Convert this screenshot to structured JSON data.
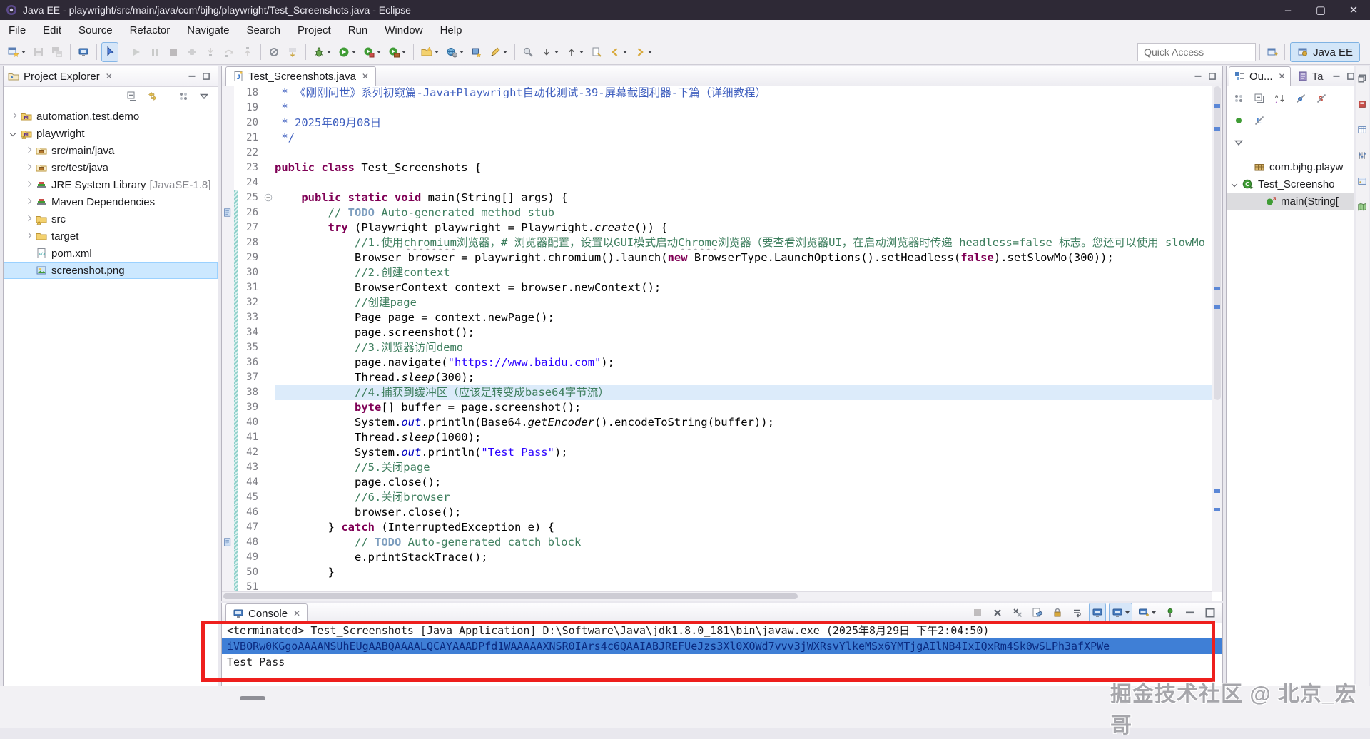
{
  "window": {
    "title": "Java EE - playwright/src/main/java/com/bjhg/playwright/Test_Screenshots.java - Eclipse",
    "minimize_label": "–",
    "maximize_label": "▢",
    "close_label": "✕"
  },
  "menu_bar": {
    "items": [
      "File",
      "Edit",
      "Source",
      "Refactor",
      "Navigate",
      "Search",
      "Project",
      "Run",
      "Window",
      "Help"
    ]
  },
  "toolbar": {
    "quick_access_placeholder": "Quick Access",
    "perspective_label": "Java EE",
    "items": [
      {
        "name": "new-wizard",
        "dropdown": true
      },
      {
        "name": "save",
        "grayed": true
      },
      {
        "name": "save-all",
        "grayed": true
      },
      {
        "sep": true
      },
      {
        "name": "console-view"
      },
      {
        "sep": true
      },
      {
        "name": "debug-pointer",
        "selected": true
      },
      {
        "sep": true
      },
      {
        "name": "resume",
        "grayed": true
      },
      {
        "name": "suspend",
        "grayed": true
      },
      {
        "name": "terminate",
        "grayed": true
      },
      {
        "name": "disconnect",
        "grayed": true
      },
      {
        "name": "step-into",
        "grayed": true
      },
      {
        "name": "step-over",
        "grayed": true
      },
      {
        "name": "step-return",
        "grayed": true
      },
      {
        "sep": true
      },
      {
        "name": "skip-breakpoints"
      },
      {
        "name": "drop-to-frame"
      },
      {
        "sep": true
      },
      {
        "name": "debug",
        "dropdown": true
      },
      {
        "name": "run",
        "dropdown": true
      },
      {
        "name": "coverage",
        "dropdown": true
      },
      {
        "name": "external-tools",
        "dropdown": true
      },
      {
        "sep": true
      },
      {
        "name": "new-project",
        "dropdown": true
      },
      {
        "name": "new-web-service",
        "dropdown": true
      },
      {
        "name": "new-servlet"
      },
      {
        "name": "annotation-pen",
        "dropdown": true
      },
      {
        "sep": true
      },
      {
        "name": "search"
      },
      {
        "name": "next-annotation",
        "dropdown": true
      },
      {
        "name": "prev-annotation",
        "dropdown": true
      },
      {
        "name": "last-edit-location"
      },
      {
        "name": "back",
        "dropdown": true
      },
      {
        "name": "forward",
        "dropdown": true
      }
    ]
  },
  "explorer": {
    "title": "Project Explorer",
    "toolbar": [
      "collapse-all",
      "link-with-editor",
      "focus-dots",
      "view-menu"
    ],
    "items": [
      {
        "label": "automation.test.demo",
        "icon": "maven-project",
        "arrow": "collapsed",
        "level": 0
      },
      {
        "label": "playwright",
        "icon": "maven-project-warn",
        "arrow": "expanded",
        "level": 0
      },
      {
        "label": "src/main/java",
        "icon": "source-folder",
        "arrow": "collapsed",
        "level": 1
      },
      {
        "label": "src/test/java",
        "icon": "source-folder",
        "arrow": "collapsed",
        "level": 1
      },
      {
        "label": "JRE System Library",
        "suffix": "[JavaSE-1.8]",
        "icon": "library",
        "arrow": "collapsed",
        "level": 1
      },
      {
        "label": "Maven Dependencies",
        "icon": "library",
        "arrow": "collapsed",
        "level": 1
      },
      {
        "label": "src",
        "icon": "folder-warn",
        "arrow": "collapsed",
        "level": 1
      },
      {
        "label": "target",
        "icon": "folder",
        "arrow": "collapsed",
        "level": 1
      },
      {
        "label": "pom.xml",
        "icon": "xml-file",
        "arrow": "none",
        "level": 1
      },
      {
        "label": "screenshot.png",
        "icon": "image-file",
        "arrow": "none",
        "level": 1,
        "selected": true
      }
    ]
  },
  "editor": {
    "tab_label": "Test_Screenshots.java",
    "lines": [
      {
        "n": 18,
        "segs": [
          [
            " * 《刚刚问世》系列初窥篇-Java+Playwright自动化测试-39-屏幕截图利器-下篇（详细教程）",
            "j"
          ]
        ]
      },
      {
        "n": 19,
        "segs": [
          [
            " *",
            "j"
          ]
        ]
      },
      {
        "n": 20,
        "segs": [
          [
            " * 2025年09月08日",
            "j"
          ]
        ]
      },
      {
        "n": 21,
        "segs": [
          [
            " */",
            "j"
          ]
        ]
      },
      {
        "n": 22,
        "segs": []
      },
      {
        "n": 23,
        "segs": [
          [
            "public class ",
            "k"
          ],
          [
            "Test_Screenshots {",
            "p"
          ]
        ]
      },
      {
        "n": 24,
        "segs": []
      },
      {
        "n": 25,
        "fold": true,
        "diff": true,
        "segs": [
          [
            "    ",
            "p"
          ],
          [
            "public static void ",
            "k"
          ],
          [
            "main(String[] args) {",
            "p"
          ]
        ]
      },
      {
        "n": 26,
        "diff": true,
        "task": true,
        "segs": [
          [
            "        ",
            "p"
          ],
          [
            "// ",
            "c"
          ],
          [
            "TODO",
            "t"
          ],
          [
            " Auto-generated method stub",
            "c"
          ]
        ]
      },
      {
        "n": 27,
        "diff": true,
        "segs": [
          [
            "        ",
            "p"
          ],
          [
            "try ",
            "k"
          ],
          [
            "(Playwright playwright = Playwright.",
            "p"
          ],
          [
            "create",
            "m"
          ],
          [
            "()) {",
            "p"
          ]
        ]
      },
      {
        "n": 28,
        "diff": true,
        "segs": [
          [
            "            ",
            "p"
          ],
          [
            "//1.使用",
            "c"
          ],
          [
            "chromium",
            "w"
          ],
          [
            "浏览器，# 浏览器配置，设置以GUI模式启动",
            "c"
          ],
          [
            "Chrome",
            "w"
          ],
          [
            "浏览器（要查看浏览器UI，在启动浏览器时传递 headless=false 标志。您还可以使用 slowMo 选项",
            "c"
          ]
        ]
      },
      {
        "n": 29,
        "diff": true,
        "segs": [
          [
            "            Browser browser = playwright.chromium().launch(",
            "p"
          ],
          [
            "new ",
            "k"
          ],
          [
            "BrowserType.LaunchOptions().setHeadless(",
            "p"
          ],
          [
            "false",
            "k"
          ],
          [
            ").setSlowMo(300));",
            "p"
          ]
        ]
      },
      {
        "n": 30,
        "diff": true,
        "segs": [
          [
            "            ",
            "p"
          ],
          [
            "//2.创建context",
            "c"
          ]
        ]
      },
      {
        "n": 31,
        "diff": true,
        "segs": [
          [
            "            BrowserContext context = browser.newContext();",
            "p"
          ]
        ]
      },
      {
        "n": 32,
        "diff": true,
        "segs": [
          [
            "            ",
            "p"
          ],
          [
            "//创建page",
            "c"
          ]
        ]
      },
      {
        "n": 33,
        "diff": true,
        "segs": [
          [
            "            Page page = context.newPage();",
            "p"
          ]
        ]
      },
      {
        "n": 34,
        "diff": true,
        "segs": [
          [
            "            page.screenshot();",
            "p"
          ]
        ]
      },
      {
        "n": 35,
        "diff": true,
        "segs": [
          [
            "            ",
            "p"
          ],
          [
            "//3.浏览器访问demo",
            "c"
          ]
        ]
      },
      {
        "n": 36,
        "diff": true,
        "segs": [
          [
            "            page.navigate(",
            "p"
          ],
          [
            "\"https://www.baidu.com\"",
            "s"
          ],
          [
            ");",
            "p"
          ]
        ]
      },
      {
        "n": 37,
        "diff": true,
        "segs": [
          [
            "            Thread.",
            "p"
          ],
          [
            "sleep",
            "m"
          ],
          [
            "(300);",
            "p"
          ]
        ]
      },
      {
        "n": 38,
        "diff": true,
        "hl": true,
        "segs": [
          [
            "            ",
            "p"
          ],
          [
            "//4.捕获到缓冲区（应该是转变成base64字节流）",
            "c"
          ]
        ]
      },
      {
        "n": 39,
        "diff": true,
        "segs": [
          [
            "            ",
            "p"
          ],
          [
            "byte",
            "k"
          ],
          [
            "[] buffer = page.screenshot();",
            "p"
          ]
        ]
      },
      {
        "n": 40,
        "diff": true,
        "segs": [
          [
            "            System.",
            "p"
          ],
          [
            "out",
            "f"
          ],
          [
            ".println(Base64.",
            "p"
          ],
          [
            "getEncoder",
            "m"
          ],
          [
            "().encodeToString(buffer));",
            "p"
          ]
        ]
      },
      {
        "n": 41,
        "diff": true,
        "segs": [
          [
            "            Thread.",
            "p"
          ],
          [
            "sleep",
            "m"
          ],
          [
            "(1000);",
            "p"
          ]
        ]
      },
      {
        "n": 42,
        "diff": true,
        "segs": [
          [
            "            System.",
            "p"
          ],
          [
            "out",
            "f"
          ],
          [
            ".println(",
            "p"
          ],
          [
            "\"Test Pass\"",
            "s"
          ],
          [
            ");",
            "p"
          ]
        ]
      },
      {
        "n": 43,
        "diff": true,
        "segs": [
          [
            "            ",
            "p"
          ],
          [
            "//5.关闭page",
            "c"
          ]
        ]
      },
      {
        "n": 44,
        "diff": true,
        "segs": [
          [
            "            page.close();",
            "p"
          ]
        ]
      },
      {
        "n": 45,
        "diff": true,
        "segs": [
          [
            "            ",
            "p"
          ],
          [
            "//6.关闭browser",
            "c"
          ]
        ]
      },
      {
        "n": 46,
        "diff": true,
        "segs": [
          [
            "            browser.close();",
            "p"
          ]
        ]
      },
      {
        "n": 47,
        "diff": true,
        "segs": [
          [
            "        } ",
            "p"
          ],
          [
            "catch ",
            "k"
          ],
          [
            "(InterruptedException e) {",
            "p"
          ]
        ]
      },
      {
        "n": 48,
        "diff": true,
        "task": true,
        "segs": [
          [
            "            ",
            "p"
          ],
          [
            "// ",
            "c"
          ],
          [
            "TODO",
            "t"
          ],
          [
            " Auto-generated catch block",
            "c"
          ]
        ]
      },
      {
        "n": 49,
        "diff": true,
        "segs": [
          [
            "            e.printStackTrace();",
            "p"
          ]
        ]
      },
      {
        "n": 50,
        "diff": true,
        "segs": [
          [
            "        }",
            "p"
          ]
        ]
      },
      {
        "n": 51,
        "diff": true,
        "segs": []
      }
    ]
  },
  "outline": {
    "tab_outline": "Ou...",
    "tab_tasks": "Ta",
    "toolbar": [
      "focus-dots",
      "collapse-all",
      "sort-az",
      "hide-fields",
      "hide-static",
      "hide-nonpublic",
      "hide-local"
    ],
    "view_menu": "view-menu",
    "items": [
      {
        "label": "com.bjhg.playw",
        "icon": "package",
        "arrow": "none",
        "level": 1
      },
      {
        "label": "Test_Screensho",
        "icon": "class-run",
        "arrow": "expanded",
        "level": 0
      },
      {
        "label": "main(String[",
        "icon": "method-static",
        "arrow": "none",
        "level": 2,
        "selected": true
      }
    ]
  },
  "console": {
    "tab_label": "Console",
    "toolbar": [
      {
        "name": "terminate-console",
        "grayed": true
      },
      {
        "name": "remove-launch"
      },
      {
        "name": "remove-all-launches"
      },
      {
        "name": "clear-console"
      },
      {
        "name": "scroll-lock"
      },
      {
        "name": "word-wrap"
      },
      {
        "name": "show-stdout",
        "selected": true
      },
      {
        "name": "display-selected-console",
        "selected": true,
        "dropdown": true
      },
      {
        "name": "open-console",
        "dropdown": true
      },
      {
        "name": "pin-console"
      },
      {
        "name": "minimize-view"
      },
      {
        "name": "maximize-view"
      }
    ],
    "lines": [
      {
        "text": "<terminated> Test_Screenshots [Java Application] D:\\Software\\Java\\jdk1.8.0_181\\bin\\javaw.exe (2025年8月29日 下午2:04:50)",
        "style": "plain"
      },
      {
        "text": "iVBORw0KGgoAAAANSUhEUgAABQAAAALQCAYAAADPfd1WAAAAAXNSR0IArs4c6QAAIABJREFUeJzs3Xl0XOWd7vvv3jWXRsvYlkeMSx6YMTjgAIlNB4IxIQxRm4Sk0wSLPh3afXPWe",
        "style": "selected"
      },
      {
        "text": "Test Pass",
        "style": "plain"
      }
    ]
  },
  "right_strip": [
    "restore-view",
    "palette-red",
    "data-table",
    "filter-sliders",
    "snippets",
    "map-view"
  ],
  "watermark": {
    "text": "掘金技术社区 @ 北京_宏哥"
  },
  "colors": {
    "titlebar": "#2e2936",
    "toolbar_bg": "#f2f1f4",
    "selection_blue": "#cce8ff",
    "line_highlight": "#dcebfa",
    "console_selection": "#3f7fd6",
    "red_annotation": "#ee1f1d",
    "keyword": "#7f0055",
    "comment": "#3f7f5f",
    "javadoc": "#3f5fbf",
    "string": "#2a00ff"
  }
}
